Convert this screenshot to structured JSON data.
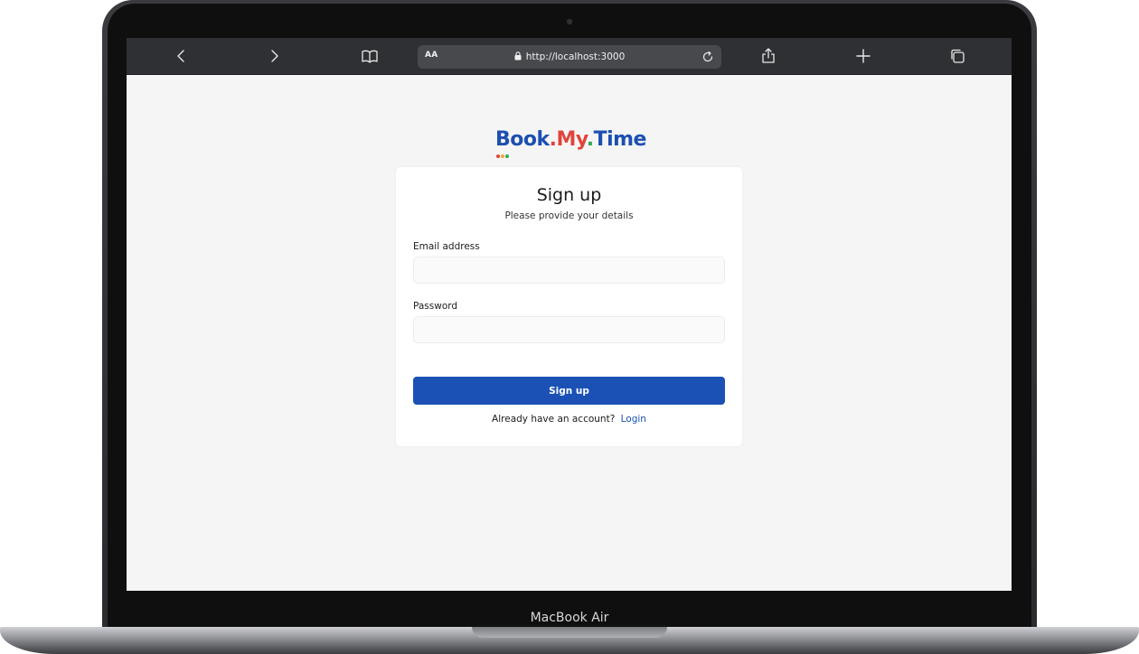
{
  "device": {
    "label": "MacBook Air"
  },
  "browser": {
    "text_size_label": "AA",
    "url": "http://localhost:3000",
    "icons": {
      "back": "chevron-left-icon",
      "forward": "chevron-right-icon",
      "bookmarks": "book-icon",
      "lock": "lock-icon",
      "reload": "reload-icon",
      "share": "share-icon",
      "new_tab": "plus-icon",
      "tabs": "tabs-icon"
    }
  },
  "brand": {
    "part1": "Book",
    "sep1": ".",
    "part2": "My",
    "sep2": ".",
    "part3": "Time",
    "colors": {
      "blue": "#1d4fb0",
      "red": "#e0443b",
      "green": "#2fab57",
      "orange": "#f2a33a"
    }
  },
  "form": {
    "title": "Sign up",
    "subtitle": "Please provide your details",
    "email": {
      "label": "Email address",
      "value": "",
      "placeholder": ""
    },
    "password": {
      "label": "Password",
      "value": "",
      "placeholder": ""
    },
    "submit_label": "Sign up",
    "footer_text": "Already have an account?",
    "login_link": "Login",
    "accent": "#1b51b5"
  }
}
